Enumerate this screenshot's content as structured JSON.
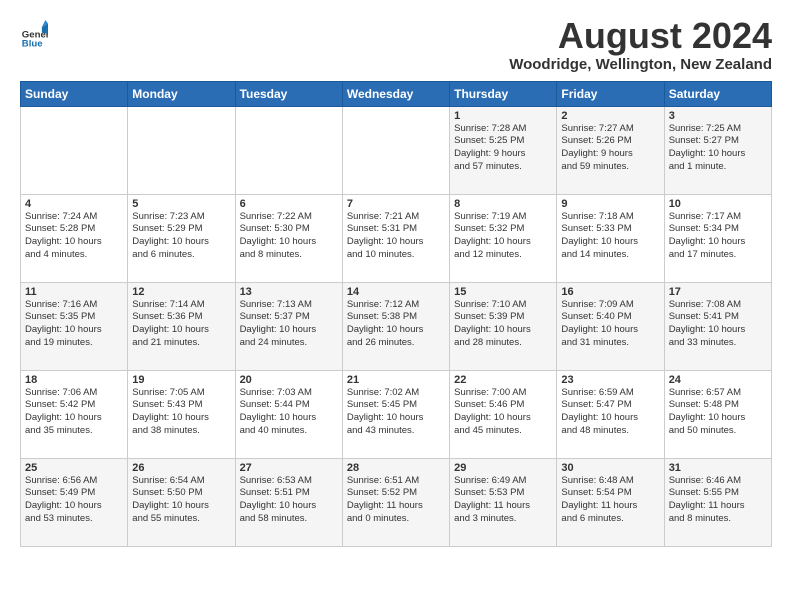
{
  "header": {
    "logo_general": "General",
    "logo_blue": "Blue",
    "month_year": "August 2024",
    "location": "Woodridge, Wellington, New Zealand"
  },
  "days_of_week": [
    "Sunday",
    "Monday",
    "Tuesday",
    "Wednesday",
    "Thursday",
    "Friday",
    "Saturday"
  ],
  "weeks": [
    [
      {
        "day": "",
        "info": ""
      },
      {
        "day": "",
        "info": ""
      },
      {
        "day": "",
        "info": ""
      },
      {
        "day": "",
        "info": ""
      },
      {
        "day": "1",
        "info": "Sunrise: 7:28 AM\nSunset: 5:25 PM\nDaylight: 9 hours\nand 57 minutes."
      },
      {
        "day": "2",
        "info": "Sunrise: 7:27 AM\nSunset: 5:26 PM\nDaylight: 9 hours\nand 59 minutes."
      },
      {
        "day": "3",
        "info": "Sunrise: 7:25 AM\nSunset: 5:27 PM\nDaylight: 10 hours\nand 1 minute."
      }
    ],
    [
      {
        "day": "4",
        "info": "Sunrise: 7:24 AM\nSunset: 5:28 PM\nDaylight: 10 hours\nand 4 minutes."
      },
      {
        "day": "5",
        "info": "Sunrise: 7:23 AM\nSunset: 5:29 PM\nDaylight: 10 hours\nand 6 minutes."
      },
      {
        "day": "6",
        "info": "Sunrise: 7:22 AM\nSunset: 5:30 PM\nDaylight: 10 hours\nand 8 minutes."
      },
      {
        "day": "7",
        "info": "Sunrise: 7:21 AM\nSunset: 5:31 PM\nDaylight: 10 hours\nand 10 minutes."
      },
      {
        "day": "8",
        "info": "Sunrise: 7:19 AM\nSunset: 5:32 PM\nDaylight: 10 hours\nand 12 minutes."
      },
      {
        "day": "9",
        "info": "Sunrise: 7:18 AM\nSunset: 5:33 PM\nDaylight: 10 hours\nand 14 minutes."
      },
      {
        "day": "10",
        "info": "Sunrise: 7:17 AM\nSunset: 5:34 PM\nDaylight: 10 hours\nand 17 minutes."
      }
    ],
    [
      {
        "day": "11",
        "info": "Sunrise: 7:16 AM\nSunset: 5:35 PM\nDaylight: 10 hours\nand 19 minutes."
      },
      {
        "day": "12",
        "info": "Sunrise: 7:14 AM\nSunset: 5:36 PM\nDaylight: 10 hours\nand 21 minutes."
      },
      {
        "day": "13",
        "info": "Sunrise: 7:13 AM\nSunset: 5:37 PM\nDaylight: 10 hours\nand 24 minutes."
      },
      {
        "day": "14",
        "info": "Sunrise: 7:12 AM\nSunset: 5:38 PM\nDaylight: 10 hours\nand 26 minutes."
      },
      {
        "day": "15",
        "info": "Sunrise: 7:10 AM\nSunset: 5:39 PM\nDaylight: 10 hours\nand 28 minutes."
      },
      {
        "day": "16",
        "info": "Sunrise: 7:09 AM\nSunset: 5:40 PM\nDaylight: 10 hours\nand 31 minutes."
      },
      {
        "day": "17",
        "info": "Sunrise: 7:08 AM\nSunset: 5:41 PM\nDaylight: 10 hours\nand 33 minutes."
      }
    ],
    [
      {
        "day": "18",
        "info": "Sunrise: 7:06 AM\nSunset: 5:42 PM\nDaylight: 10 hours\nand 35 minutes."
      },
      {
        "day": "19",
        "info": "Sunrise: 7:05 AM\nSunset: 5:43 PM\nDaylight: 10 hours\nand 38 minutes."
      },
      {
        "day": "20",
        "info": "Sunrise: 7:03 AM\nSunset: 5:44 PM\nDaylight: 10 hours\nand 40 minutes."
      },
      {
        "day": "21",
        "info": "Sunrise: 7:02 AM\nSunset: 5:45 PM\nDaylight: 10 hours\nand 43 minutes."
      },
      {
        "day": "22",
        "info": "Sunrise: 7:00 AM\nSunset: 5:46 PM\nDaylight: 10 hours\nand 45 minutes."
      },
      {
        "day": "23",
        "info": "Sunrise: 6:59 AM\nSunset: 5:47 PM\nDaylight: 10 hours\nand 48 minutes."
      },
      {
        "day": "24",
        "info": "Sunrise: 6:57 AM\nSunset: 5:48 PM\nDaylight: 10 hours\nand 50 minutes."
      }
    ],
    [
      {
        "day": "25",
        "info": "Sunrise: 6:56 AM\nSunset: 5:49 PM\nDaylight: 10 hours\nand 53 minutes."
      },
      {
        "day": "26",
        "info": "Sunrise: 6:54 AM\nSunset: 5:50 PM\nDaylight: 10 hours\nand 55 minutes."
      },
      {
        "day": "27",
        "info": "Sunrise: 6:53 AM\nSunset: 5:51 PM\nDaylight: 10 hours\nand 58 minutes."
      },
      {
        "day": "28",
        "info": "Sunrise: 6:51 AM\nSunset: 5:52 PM\nDaylight: 11 hours\nand 0 minutes."
      },
      {
        "day": "29",
        "info": "Sunrise: 6:49 AM\nSunset: 5:53 PM\nDaylight: 11 hours\nand 3 minutes."
      },
      {
        "day": "30",
        "info": "Sunrise: 6:48 AM\nSunset: 5:54 PM\nDaylight: 11 hours\nand 6 minutes."
      },
      {
        "day": "31",
        "info": "Sunrise: 6:46 AM\nSunset: 5:55 PM\nDaylight: 11 hours\nand 8 minutes."
      }
    ]
  ]
}
